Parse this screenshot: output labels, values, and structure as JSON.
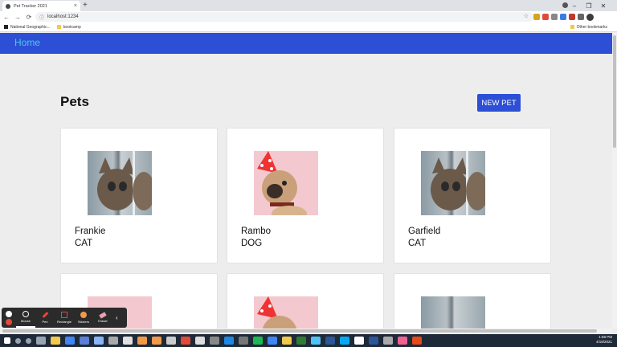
{
  "browser": {
    "tab_title": "Pet Tracker 2021",
    "tab_close": "×",
    "new_tab": "+",
    "url": "localhost:1234",
    "back": "←",
    "forward": "→",
    "reload": "⟳",
    "bookmarks": [
      "National Geographic...",
      "bootcamp"
    ],
    "other_bookmarks": "Other bookmarks",
    "window_controls": [
      "–",
      "❐",
      "✕"
    ]
  },
  "app": {
    "nav_home": "Home",
    "page_title": "Pets",
    "new_pet_button": "NEW PET"
  },
  "pets": [
    {
      "name": "Frankie",
      "type": "CAT",
      "image": "cat-photo"
    },
    {
      "name": "Rambo",
      "type": "DOG",
      "image": "dog-photo"
    },
    {
      "name": "Garfield",
      "type": "CAT",
      "image": "cat-photo"
    },
    {
      "name": "",
      "type": "",
      "image": "dog-photo"
    },
    {
      "name": "",
      "type": "",
      "image": "dog-photo"
    },
    {
      "name": "",
      "type": "",
      "image": "cat-photo"
    }
  ],
  "recorder": {
    "tools": [
      "Mouse",
      "Pen",
      "Rectangle",
      "Stickers",
      "Eraser"
    ],
    "collapse": "‹"
  },
  "taskbar": {
    "time": "1:58 PM",
    "date": "4/18/2021"
  },
  "colors": {
    "appbar": "#2d4fd6",
    "home_link": "#4ec9e8",
    "button": "#2d4fd6"
  }
}
